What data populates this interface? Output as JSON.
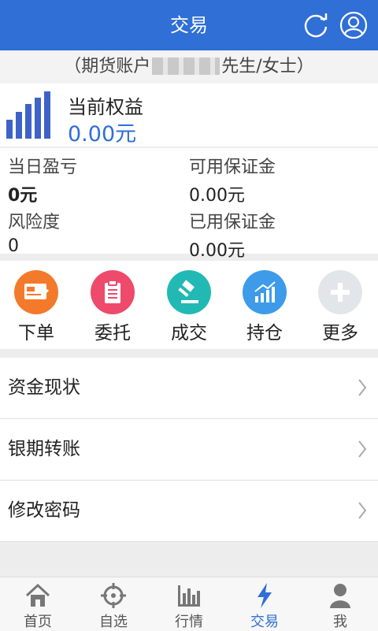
{
  "header": {
    "title": "交易"
  },
  "account": {
    "prefix": "（期货账户",
    "suffix": "先生/女士）"
  },
  "equity": {
    "label": "当前权益",
    "value": "0.00元"
  },
  "stats": {
    "daily_pl": {
      "label": "当日盈亏",
      "value": "0元"
    },
    "available_margin": {
      "label": "可用保证金",
      "value": "0.00元"
    },
    "risk": {
      "label": "风险度",
      "value": "0"
    },
    "used_margin": {
      "label": "已用保证金",
      "value": "0.00元"
    }
  },
  "actions": [
    {
      "label": "下单",
      "icon": "order-icon",
      "color": "#f47a2b"
    },
    {
      "label": "委托",
      "icon": "clipboard-icon",
      "color": "#ee4a6b"
    },
    {
      "label": "成交",
      "icon": "gavel-icon",
      "color": "#22b9b4"
    },
    {
      "label": "持仓",
      "icon": "chart-up-icon",
      "color": "#3d9be9"
    },
    {
      "label": "更多",
      "icon": "plus-icon",
      "color": "#e2e6ea"
    }
  ],
  "menu": [
    {
      "label": "资金现状"
    },
    {
      "label": "银期转账"
    },
    {
      "label": "修改密码"
    }
  ],
  "tabs": [
    {
      "label": "首页",
      "icon": "home-icon"
    },
    {
      "label": "自选",
      "icon": "crosshair-icon"
    },
    {
      "label": "行情",
      "icon": "bar-chart-icon"
    },
    {
      "label": "交易",
      "icon": "lightning-icon",
      "active": true
    },
    {
      "label": "我",
      "icon": "person-icon"
    }
  ],
  "colors": {
    "brand": "#2f6fd6",
    "equity_value": "#2f6fd6"
  }
}
